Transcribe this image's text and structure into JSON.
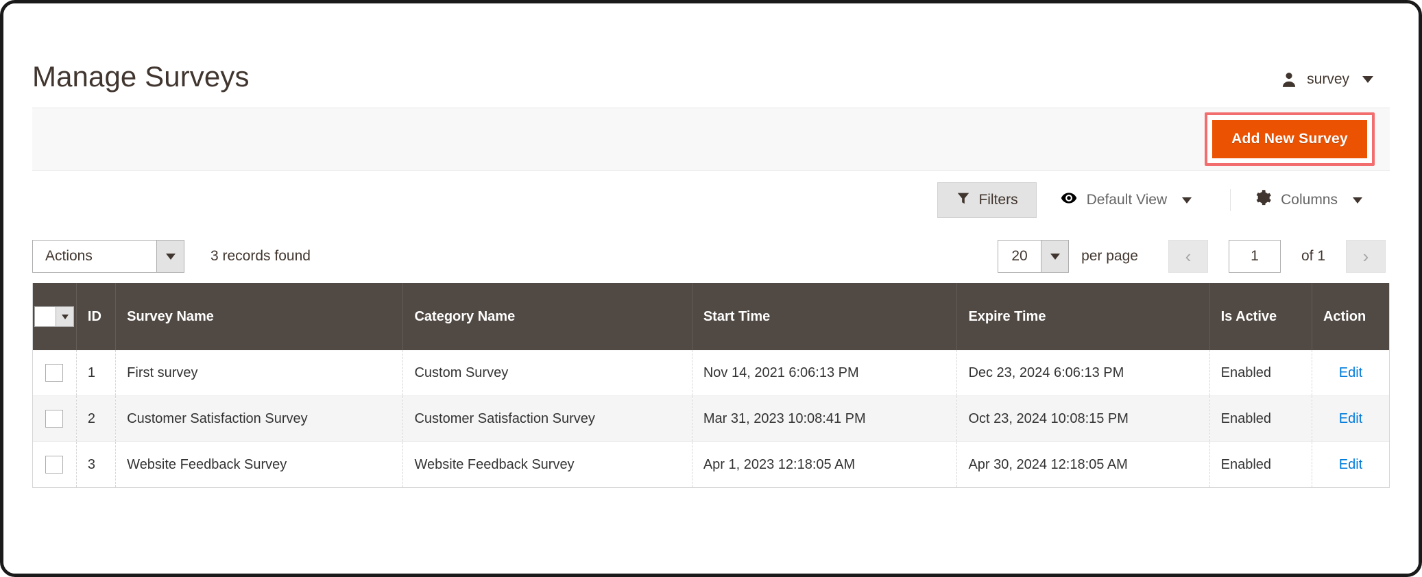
{
  "header": {
    "title": "Manage Surveys",
    "user": {
      "icon": "user-icon",
      "name": "survey",
      "caret": "chevron-down-icon"
    }
  },
  "page_actions": {
    "add_new_label": "Add New Survey",
    "highlight_color": "#f26d6d",
    "button_color": "#eb5202"
  },
  "grid_toolbar": {
    "filters_label": "Filters",
    "filters_icon": "funnel-icon",
    "view_label": "Default View",
    "view_icon": "eye-icon",
    "columns_label": "Columns",
    "columns_icon": "gear-icon"
  },
  "grid_controls": {
    "actions_label": "Actions",
    "records_found": "3 records found",
    "per_page_value": "20",
    "per_page_label": "per page",
    "prev_icon": "‹",
    "next_icon": "›",
    "page_value": "1",
    "of_total": "of 1"
  },
  "grid": {
    "columns": [
      "ID",
      "Survey Name",
      "Category Name",
      "Start Time",
      "Expire Time",
      "Is Active",
      "Action"
    ],
    "rows": [
      {
        "id": "1",
        "survey_name": "First survey",
        "category_name": "Custom Survey",
        "start_time": "Nov 14, 2021 6:06:13 PM",
        "expire_time": "Dec 23, 2024 6:06:13 PM",
        "is_active": "Enabled",
        "action": "Edit"
      },
      {
        "id": "2",
        "survey_name": "Customer Satisfaction Survey",
        "category_name": "Customer Satisfaction Survey",
        "start_time": "Mar 31, 2023 10:08:41 PM",
        "expire_time": "Oct 23, 2024 10:08:15 PM",
        "is_active": "Enabled",
        "action": "Edit"
      },
      {
        "id": "3",
        "survey_name": "Website Feedback Survey",
        "category_name": "Website Feedback Survey",
        "start_time": "Apr 1, 2023 12:18:05 AM",
        "expire_time": "Apr 30, 2024 12:18:05 AM",
        "is_active": "Enabled",
        "action": "Edit"
      }
    ]
  },
  "colors": {
    "accent_orange": "#eb5202",
    "header_brown": "#514943",
    "link_blue": "#007bdb",
    "highlight_red": "#f26d6d"
  }
}
